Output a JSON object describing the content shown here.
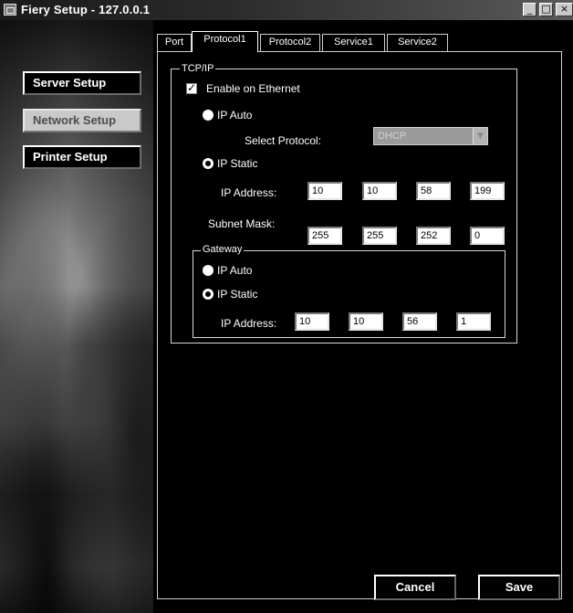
{
  "window": {
    "title": "Fiery Setup - 127.0.0.1",
    "controls": {
      "minimize": "_",
      "maximize": "□",
      "close": "×"
    }
  },
  "sidebar": {
    "items": [
      {
        "label": "Server Setup"
      },
      {
        "label": "Network Setup",
        "active": true
      },
      {
        "label": "Printer Setup"
      }
    ]
  },
  "tabs": [
    {
      "label": "Port"
    },
    {
      "label": "Protocol1",
      "active": true
    },
    {
      "label": "Protocol2"
    },
    {
      "label": "Service1"
    },
    {
      "label": "Service2"
    }
  ],
  "tcpip": {
    "legend": "TCP/IP",
    "enable_ethernet": {
      "label": "Enable on Ethernet",
      "checked": true
    },
    "ip_auto_label": "IP Auto",
    "select_protocol_label": "Select Protocol:",
    "select_protocol_value": "DHCP",
    "ip_static_label": "IP Static",
    "ip_address_label": "IP Address:",
    "ip_address": [
      "10",
      "10",
      "58",
      "199"
    ],
    "subnet_mask_label": "Subnet Mask:",
    "subnet_mask": [
      "255",
      "255",
      "252",
      "0"
    ],
    "selected_mode": "IP Static"
  },
  "gateway": {
    "legend": "Gateway",
    "ip_auto_label": "IP Auto",
    "ip_static_label": "IP Static",
    "ip_address_label": "IP Address:",
    "ip_address": [
      "10",
      "10",
      "56",
      "1"
    ],
    "selected_mode": "IP Static"
  },
  "actions": {
    "cancel_label": "Cancel",
    "save_label": "Save"
  }
}
